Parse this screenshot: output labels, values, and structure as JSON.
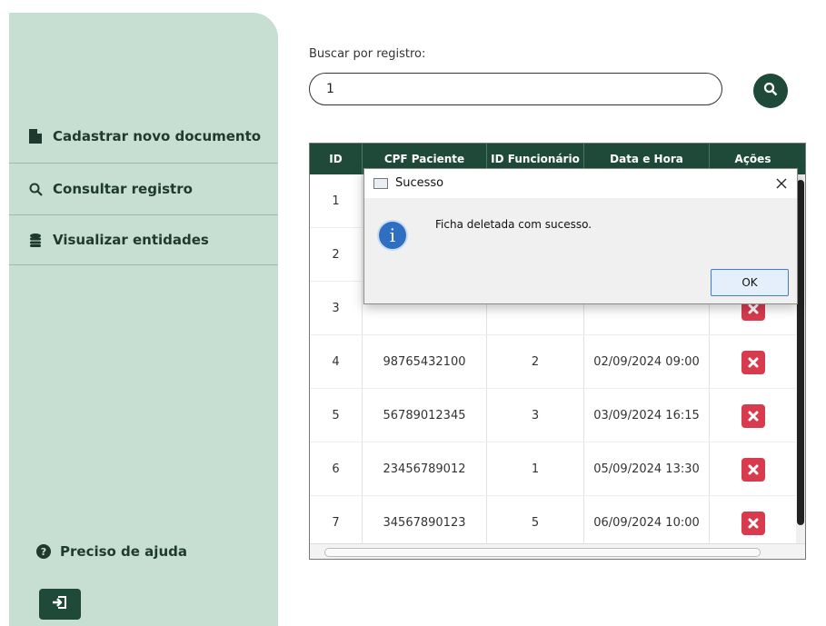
{
  "sidebar": {
    "items": [
      {
        "label": "Cadastrar novo documento",
        "icon": "document-icon"
      },
      {
        "label": "Consultar registro",
        "icon": "search-icon"
      },
      {
        "label": "Visualizar entidades",
        "icon": "database-icon"
      }
    ],
    "help_label": "Preciso de ajuda",
    "help_icon": "question-circle-icon",
    "logout_icon": "sign-out-icon"
  },
  "search": {
    "label": "Buscar por registro:",
    "value": "1",
    "button_icon": "search-icon"
  },
  "table": {
    "columns": [
      "ID",
      "CPF Paciente",
      "ID Funcionário",
      "Data e Hora",
      "Ações"
    ],
    "rows": [
      {
        "id": "1",
        "cpf": "",
        "func": "",
        "datetime": ""
      },
      {
        "id": "2",
        "cpf": "",
        "func": "",
        "datetime": ""
      },
      {
        "id": "3",
        "cpf": "",
        "func": "",
        "datetime": ""
      },
      {
        "id": "4",
        "cpf": "98765432100",
        "func": "2",
        "datetime": "02/09/2024 09:00"
      },
      {
        "id": "5",
        "cpf": "56789012345",
        "func": "3",
        "datetime": "03/09/2024 16:15"
      },
      {
        "id": "6",
        "cpf": "23456789012",
        "func": "1",
        "datetime": "05/09/2024 13:30"
      },
      {
        "id": "7",
        "cpf": "34567890123",
        "func": "5",
        "datetime": "06/09/2024 10:00"
      }
    ],
    "delete_icon": "close-icon"
  },
  "dialog": {
    "title": "Sucesso",
    "message": "Ficha deletada com sucesso.",
    "ok_label": "OK",
    "icon": "info-icon"
  },
  "colors": {
    "sidebar_bg": "#c7dfd3",
    "accent": "#1f4a3a",
    "danger": "#d83a4e"
  }
}
